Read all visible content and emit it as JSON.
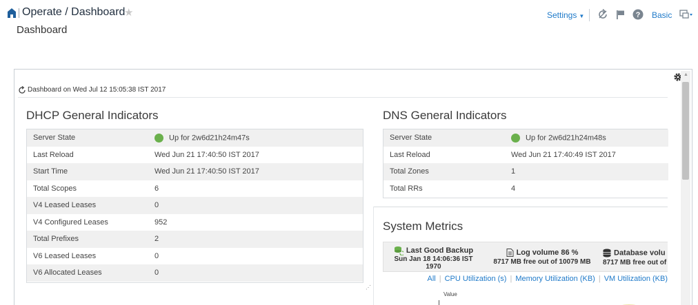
{
  "header": {
    "breadcrumb": "Operate / Dashboard",
    "page_title": "Dashboard",
    "settings_label": "Settings",
    "mode_label": "Basic"
  },
  "dashboard": {
    "refresh_text": "Dashboard on Wed Jul 12 15:05:38 IST 2017"
  },
  "dhcp": {
    "title": "DHCP General Indicators",
    "rows": [
      {
        "label": "Server State",
        "value": "Up for 2w6d21h24m47s"
      },
      {
        "label": "Last Reload",
        "value": "Wed Jun 21 17:40:50 IST 2017"
      },
      {
        "label": "Start Time",
        "value": "Wed Jun 21 17:40:50 IST 2017"
      },
      {
        "label": "Total Scopes",
        "value": "6"
      },
      {
        "label": "V4 Leased Leases",
        "value": "0"
      },
      {
        "label": "V4 Configured Leases",
        "value": "952"
      },
      {
        "label": "Total Prefixes",
        "value": "2"
      },
      {
        "label": "V6 Leased Leases",
        "value": "0"
      },
      {
        "label": "V6 Allocated Leases",
        "value": "0"
      }
    ]
  },
  "dns": {
    "title": "DNS General Indicators",
    "rows": [
      {
        "label": "Server State",
        "value": "Up for 2w6d21h24m48s"
      },
      {
        "label": "Last Reload",
        "value": "Wed Jun 21 17:40:49 IST 2017"
      },
      {
        "label": "Total Zones",
        "value": "1"
      },
      {
        "label": "Total RRs",
        "value": "4"
      }
    ]
  },
  "metrics": {
    "title": "System Metrics",
    "tiles": [
      {
        "title": "Last Good Backup",
        "line2": "Sun Jan 18 14:06:36 IST",
        "line3": "1970"
      },
      {
        "title": "Log volume 86 %",
        "line2": "8717 MB free out of 10079 MB"
      },
      {
        "title": "Database volu",
        "line2": "8717 MB free out of"
      }
    ],
    "tabs": [
      "All",
      "CPU Utilization (s)",
      "Memory Utilization (KB)",
      "VM Utilization (KB)"
    ],
    "chart_axis_label": "Value"
  },
  "colors": {
    "accent": "#1f7ac9",
    "status_up": "#6ab04c"
  }
}
